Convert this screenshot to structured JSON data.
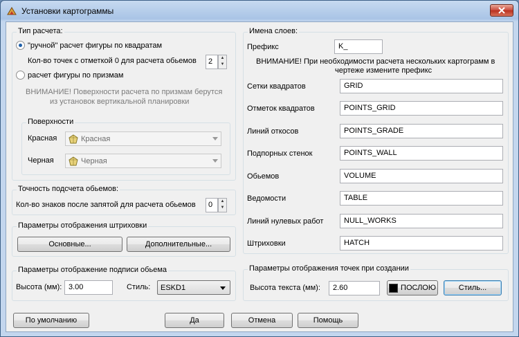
{
  "window": {
    "title": "Установки картограммы"
  },
  "calc": {
    "label": "Тип расчета:",
    "manual_label": "\"ручной\" расчет фигуры по квадратам",
    "points_label": "Кол-во точек с отметкой 0 для расчета обьемов",
    "points_value": "2",
    "prism_label": "расчет фигуры по призмам",
    "warning_line1": "ВНИМАНИЕ! Поверхности расчета по призмам берутся",
    "warning_line2": "из установок вертикальной планировки",
    "surfaces": {
      "label": "Поверхности",
      "red_label": "Красная",
      "red_value": "Красная",
      "black_label": "Черная",
      "black_value": "Черная"
    }
  },
  "accuracy": {
    "label": "Точность подсчета обьемов:",
    "digits_label": "Кол-во знаков после запятой для расчета обьемов",
    "digits_value": "0"
  },
  "hatch": {
    "label": "Параметры отображения штриховки",
    "basic_button": "Основные...",
    "extra_button": "Дополнительные..."
  },
  "volume_label": {
    "label": "Параметры отображение подписи обьема",
    "height_label": "Высота (мм):",
    "height_value": "3.00",
    "style_label": "Стиль:",
    "style_value": "ESKD1"
  },
  "layers": {
    "label": "Имена слоев:",
    "prefix_label": "Префикс",
    "prefix_value": "K_",
    "warning_line1": "ВНИМАНИЕ! При необходимости расчета нескольких картограмм в",
    "warning_line2": "чертеже измените префикс",
    "rows": [
      {
        "label": "Сетки квадратов",
        "value": "GRID"
      },
      {
        "label": "Отметок квадратов",
        "value": "POINTS_GRID"
      },
      {
        "label": "Линий  откосов",
        "value": "POINTS_GRADE"
      },
      {
        "label": "Подпорных стенок",
        "value": "POINTS_WALL"
      },
      {
        "label": "Обьемов",
        "value": "VOLUME"
      },
      {
        "label": "Ведомости",
        "value": "TABLE"
      },
      {
        "label": "Линий нулевых работ",
        "value": "NULL_WORKS"
      },
      {
        "label": "Штриховки",
        "value": "HATCH"
      }
    ]
  },
  "points_display": {
    "label": "Параметры отображения точек при создании",
    "text_height_label": "Высота текста (мм):",
    "text_height_value": "2.60",
    "color_label": "ПОСЛОЮ",
    "style_button": "Стиль..."
  },
  "footer": {
    "default_button": "По умолчанию",
    "ok_button": "Да",
    "cancel_button": "Отмена",
    "help_button": "Помощь"
  }
}
